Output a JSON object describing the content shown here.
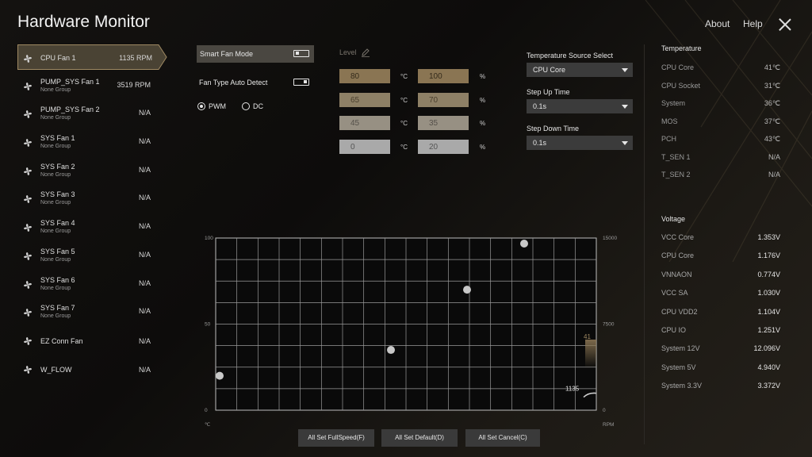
{
  "app": {
    "title": "Hardware Monitor",
    "about": "About",
    "help": "Help"
  },
  "fans": [
    {
      "name": "CPU Fan 1",
      "group": "",
      "rpm": "1135 RPM",
      "active": true
    },
    {
      "name": "PUMP_SYS Fan 1",
      "group": "None Group",
      "rpm": "3519 RPM"
    },
    {
      "name": "PUMP_SYS Fan 2",
      "group": "None Group",
      "rpm": "N/A"
    },
    {
      "name": "SYS Fan 1",
      "group": "None Group",
      "rpm": "N/A"
    },
    {
      "name": "SYS Fan 2",
      "group": "None Group",
      "rpm": "N/A"
    },
    {
      "name": "SYS Fan 3",
      "group": "None Group",
      "rpm": "N/A"
    },
    {
      "name": "SYS Fan 4",
      "group": "None Group",
      "rpm": "N/A"
    },
    {
      "name": "SYS Fan 5",
      "group": "None Group",
      "rpm": "N/A"
    },
    {
      "name": "SYS Fan 6",
      "group": "None Group",
      "rpm": "N/A"
    },
    {
      "name": "SYS Fan 7",
      "group": "None Group",
      "rpm": "N/A"
    },
    {
      "name": "EZ Conn Fan",
      "group": "",
      "rpm": "N/A"
    },
    {
      "name": "W_FLOW",
      "group": "",
      "rpm": "N/A"
    }
  ],
  "controls": {
    "smart_fan_mode": "Smart Fan Mode",
    "smart_fan_mode_on": false,
    "auto_detect": "Fan Type Auto Detect",
    "auto_detect_on": true,
    "pwm": "PWM",
    "dc": "DC",
    "selected_mode": "PWM"
  },
  "levels": {
    "title": "Level",
    "temp_unit": "°C",
    "pct_unit": "%",
    "rows": [
      {
        "temp": "80",
        "pct": "100"
      },
      {
        "temp": "65",
        "pct": "70"
      },
      {
        "temp": "45",
        "pct": "35"
      },
      {
        "temp": "0",
        "pct": "20"
      }
    ]
  },
  "settings": {
    "temp_source": {
      "label": "Temperature Source Select",
      "value": "CPU Core"
    },
    "step_up": {
      "label": "Step Up Time",
      "value": "0.1s"
    },
    "step_down": {
      "label": "Step Down Time",
      "value": "0.1s"
    }
  },
  "temperature": {
    "title": "Temperature",
    "items": [
      {
        "name": "CPU Core",
        "value": "41℃"
      },
      {
        "name": "CPU Socket",
        "value": "31℃"
      },
      {
        "name": "System",
        "value": "36℃"
      },
      {
        "name": "MOS",
        "value": "37℃"
      },
      {
        "name": "PCH",
        "value": "43℃"
      },
      {
        "name": "T_SEN 1",
        "value": "N/A"
      },
      {
        "name": "T_SEN 2",
        "value": "N/A"
      }
    ]
  },
  "voltage": {
    "title": "Voltage",
    "items": [
      {
        "name": "VCC Core",
        "value": "1.353V"
      },
      {
        "name": "CPU Core",
        "value": "1.176V"
      },
      {
        "name": "VNNAON",
        "value": "0.774V"
      },
      {
        "name": "VCC SA",
        "value": "1.030V"
      },
      {
        "name": "CPU VDD2",
        "value": "1.104V"
      },
      {
        "name": "CPU IO",
        "value": "1.251V"
      },
      {
        "name": "System 12V",
        "value": "12.096V"
      },
      {
        "name": "System 5V",
        "value": "4.940V"
      },
      {
        "name": "System 3.3V",
        "value": "3.372V"
      }
    ]
  },
  "chart_data": {
    "type": "scatter",
    "x_unit": "℃",
    "y2_unit": "RPM",
    "y_ticks": [
      "100",
      "50",
      "0"
    ],
    "y2_ticks": [
      "15000",
      "7500",
      "0"
    ],
    "xlim": [
      0,
      100
    ],
    "ylim": [
      0,
      100
    ],
    "y2lim": [
      0,
      15000
    ],
    "points": [
      [
        0,
        20
      ],
      [
        45,
        35
      ],
      [
        65,
        70
      ],
      [
        80,
        100
      ]
    ],
    "current_temp": 41,
    "current_temp_label": "41",
    "current_rpm": 1135,
    "current_rpm_label": "1135",
    "grid": true
  },
  "buttons": {
    "fullspeed": "All Set FullSpeed(F)",
    "default": "All Set Default(D)",
    "cancel": "All Set Cancel(C)"
  },
  "colors": {
    "accent": "#a08a63",
    "active_bg": "#4a4334",
    "panel": "#3b3b3b"
  }
}
